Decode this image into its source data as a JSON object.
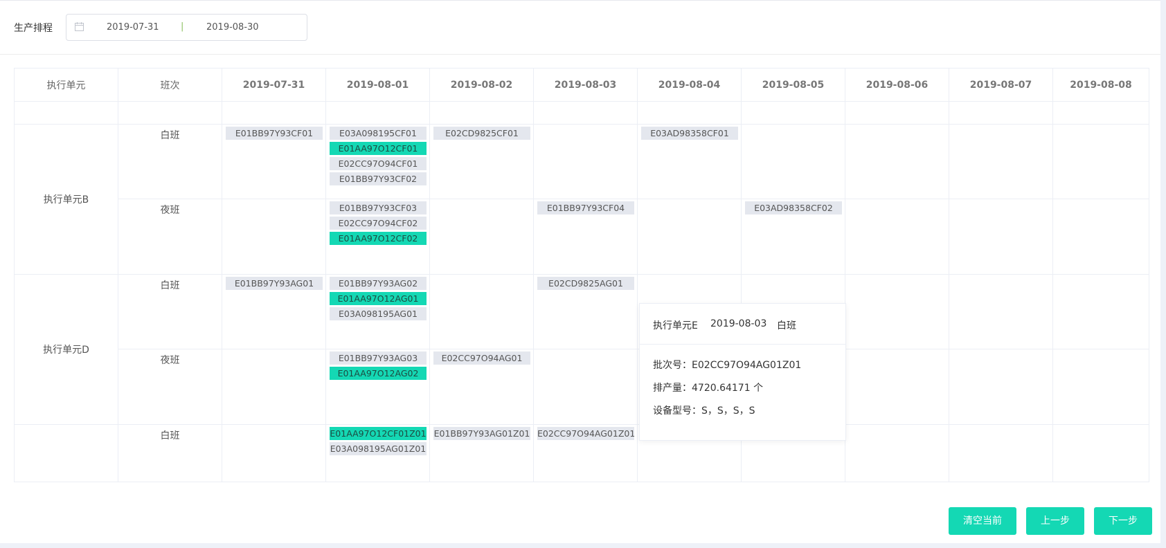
{
  "filter": {
    "label": "生产排程",
    "start_date": "2019-07-31",
    "separator": "|",
    "end_date": "2019-08-30",
    "icon": "calendar-icon"
  },
  "table": {
    "headers": [
      "执行单元",
      "班次",
      "2019-07-31",
      "2019-08-01",
      "2019-08-02",
      "2019-08-03",
      "2019-08-04",
      "2019-08-05",
      "2019-08-06",
      "2019-08-07",
      "2019-08-08"
    ],
    "groups": [
      {
        "unit": "执行单元B",
        "shifts": [
          {
            "name": "白班",
            "cells": [
              [
                {
                  "id": "E01BB97Y93CF01",
                  "hl": false
                }
              ],
              [
                {
                  "id": "E03A098195CF01",
                  "hl": false
                },
                {
                  "id": "E01AA97O12CF01",
                  "hl": true
                },
                {
                  "id": "E02CC97O94CF01",
                  "hl": false
                },
                {
                  "id": "E01BB97Y93CF02",
                  "hl": false
                }
              ],
              [
                {
                  "id": "E02CD9825CF01",
                  "hl": false
                }
              ],
              [],
              [
                {
                  "id": "E03AD98358CF01",
                  "hl": false
                }
              ],
              [],
              [],
              [],
              []
            ]
          },
          {
            "name": "夜班",
            "cells": [
              [],
              [
                {
                  "id": "E01BB97Y93CF03",
                  "hl": false
                },
                {
                  "id": "E02CC97O94CF02",
                  "hl": false
                },
                {
                  "id": "E01AA97O12CF02",
                  "hl": true
                }
              ],
              [],
              [
                {
                  "id": "E01BB97Y93CF04",
                  "hl": false
                }
              ],
              [],
              [
                {
                  "id": "E03AD98358CF02",
                  "hl": false
                }
              ],
              [],
              [],
              []
            ]
          }
        ]
      },
      {
        "unit": "执行单元D",
        "shifts": [
          {
            "name": "白班",
            "cells": [
              [
                {
                  "id": "E01BB97Y93AG01",
                  "hl": false
                }
              ],
              [
                {
                  "id": "E01BB97Y93AG02",
                  "hl": false
                },
                {
                  "id": "E01AA97O12AG01",
                  "hl": true
                },
                {
                  "id": "E03A098195AG01",
                  "hl": false
                }
              ],
              [],
              [
                {
                  "id": "E02CD9825AG01",
                  "hl": false
                }
              ],
              [],
              [],
              [],
              [],
              []
            ]
          },
          {
            "name": "夜班",
            "cells": [
              [],
              [
                {
                  "id": "E01BB97Y93AG03",
                  "hl": false
                },
                {
                  "id": "E01AA97O12AG02",
                  "hl": true
                }
              ],
              [
                {
                  "id": "E02CC97O94AG01",
                  "hl": false
                }
              ],
              [],
              [],
              [],
              [],
              [],
              []
            ]
          }
        ]
      },
      {
        "unit": "",
        "shifts": [
          {
            "name": "白班",
            "cells": [
              [],
              [
                {
                  "id": "E01AA97O12CF01Z01",
                  "hl": true
                },
                {
                  "id": "E03A098195AG01Z01",
                  "hl": false
                }
              ],
              [
                {
                  "id": "E01BB97Y93AG01Z01",
                  "hl": false
                }
              ],
              [
                {
                  "id": "E02CC97O94AG01Z01",
                  "hl": false
                }
              ],
              [],
              [],
              [],
              [],
              []
            ]
          }
        ]
      }
    ]
  },
  "tooltip": {
    "unit": "执行单元E",
    "date": "2019-08-03",
    "shift": "白班",
    "batch_label": "批次号：",
    "batch_value": "E02CC97O94AG01Z01",
    "qty_label": "排产量：",
    "qty_value": "4720.64171 个",
    "model_label": "设备型号：",
    "model_value": "S，S，S，S"
  },
  "buttons": {
    "clear": "清空当前",
    "prev": "上一步",
    "next": "下一步"
  },
  "colors": {
    "accent": "#14d8b4",
    "chip_bg": "#e4e7ee"
  }
}
